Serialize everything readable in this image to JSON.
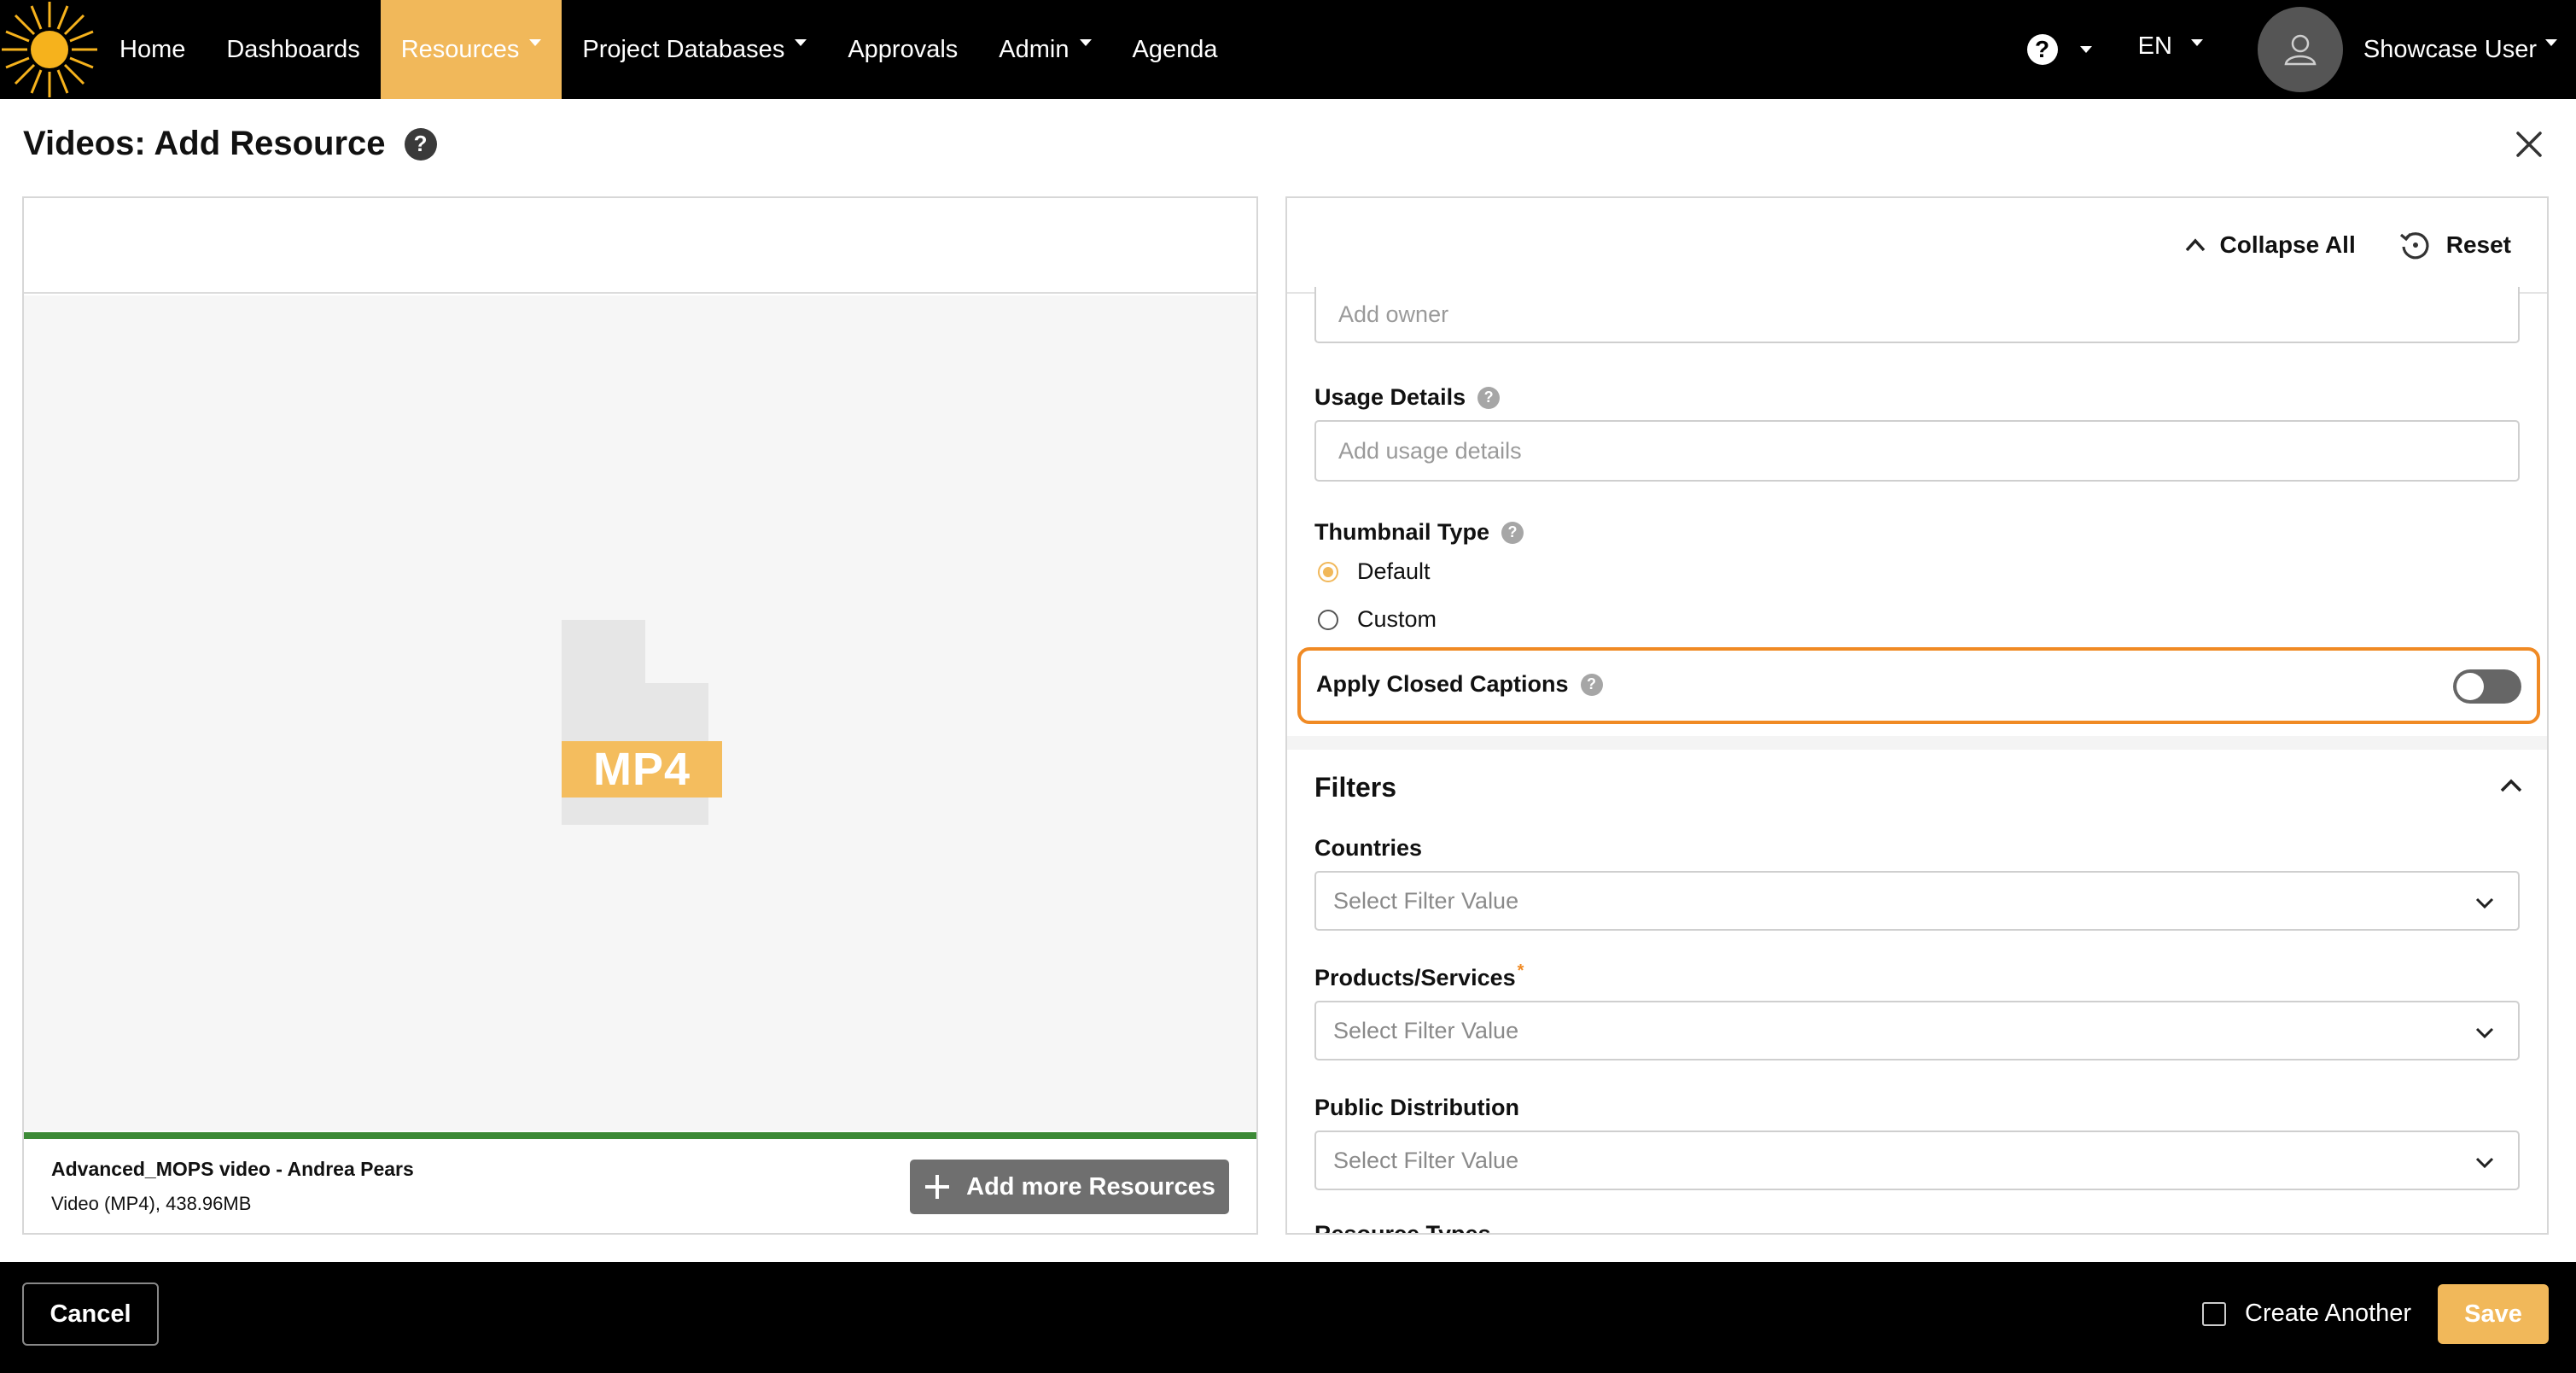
{
  "nav": {
    "items": [
      {
        "label": "Home",
        "dropdown": false,
        "active": false
      },
      {
        "label": "Dashboards",
        "dropdown": false,
        "active": false
      },
      {
        "label": "Resources",
        "dropdown": true,
        "active": true
      },
      {
        "label": "Project Databases",
        "dropdown": true,
        "active": false
      },
      {
        "label": "Approvals",
        "dropdown": false,
        "active": false
      },
      {
        "label": "Admin",
        "dropdown": true,
        "active": false
      },
      {
        "label": "Agenda",
        "dropdown": false,
        "active": false
      }
    ],
    "help_icon": "question-circle-icon",
    "language": "EN",
    "user_name": "Showcase User",
    "accent_color": "#f1b85a"
  },
  "page": {
    "title": "Videos: Add Resource",
    "close_icon": "close-icon"
  },
  "preview": {
    "file_badge": "MP4",
    "file_name": "Advanced_MOPS video - Andrea Pears",
    "file_meta": "Video (MP4), 438.96MB",
    "progress_percent": 100,
    "progress_color": "#3d8b37",
    "add_more_label": "Add more Resources"
  },
  "form": {
    "collapse_all_label": "Collapse All",
    "reset_label": "Reset",
    "owner_placeholder": "Add owner",
    "usage_details": {
      "label": "Usage Details",
      "placeholder": "Add usage details"
    },
    "thumbnail_type": {
      "label": "Thumbnail Type",
      "options": [
        {
          "label": "Default",
          "selected": true
        },
        {
          "label": "Custom",
          "selected": false
        }
      ]
    },
    "closed_captions": {
      "label": "Apply Closed Captions",
      "enabled": false,
      "highlight_color": "#f08a24"
    },
    "filters": {
      "title": "Filters",
      "fields": [
        {
          "label": "Countries",
          "required": false,
          "placeholder": "Select Filter Value"
        },
        {
          "label": "Products/Services",
          "required": true,
          "required_mark": "*",
          "placeholder": "Select Filter Value"
        },
        {
          "label": "Public Distribution",
          "required": false,
          "placeholder": "Select Filter Value"
        }
      ],
      "partial_label": "Resource Types"
    }
  },
  "footer": {
    "cancel_label": "Cancel",
    "create_another_label": "Create Another",
    "create_another_checked": false,
    "save_label": "Save"
  }
}
